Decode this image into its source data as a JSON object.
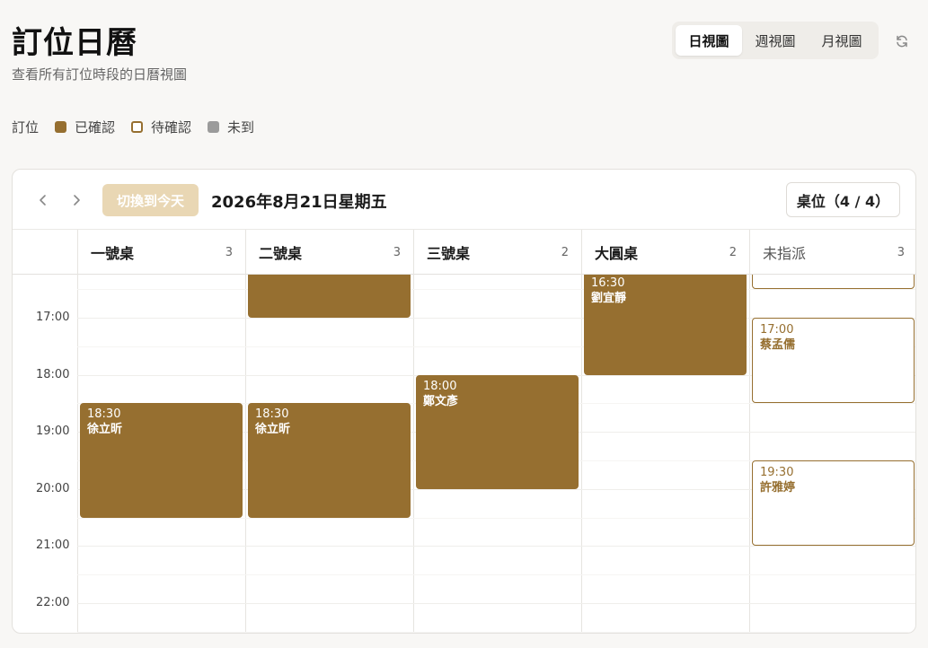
{
  "header": {
    "title": "訂位日曆",
    "subtitle": "查看所有訂位時段的日曆視圖",
    "views": [
      "日視圖",
      "週視圖",
      "月視圖"
    ],
    "active_view": "日視圖"
  },
  "legend": {
    "label": "訂位",
    "items": [
      {
        "label": "已確認",
        "status": "confirmed",
        "color": "#966f30"
      },
      {
        "label": "待確認",
        "status": "pending",
        "color": "#966f30"
      },
      {
        "label": "未到",
        "status": "noshow",
        "color": "#9b9b9b"
      }
    ]
  },
  "toolbar": {
    "today_label": "切換到今天",
    "date_label": "2026年8月21日星期五",
    "tables_label": "桌位（4 / 4）"
  },
  "columns": [
    {
      "name": "一號桌",
      "count": "3"
    },
    {
      "name": "二號桌",
      "count": "3"
    },
    {
      "name": "三號桌",
      "count": "2"
    },
    {
      "name": "大圓桌",
      "count": "2"
    },
    {
      "name": "未指派",
      "count": "3"
    }
  ],
  "time_labels": [
    "17:00",
    "18:00",
    "19:00",
    "20:00",
    "21:00",
    "22:00"
  ],
  "events": [
    {
      "column": 1,
      "time": "",
      "name": "",
      "status": "confirmed",
      "start_hour": 16.2,
      "end_hour": 17.0
    },
    {
      "column": 3,
      "time": "16:30",
      "name": "劉宜靜",
      "status": "confirmed",
      "start_hour": 16.2,
      "end_hour": 18.0
    },
    {
      "column": 4,
      "time": "",
      "name": "",
      "status": "pending",
      "start_hour": 16.2,
      "end_hour": 16.5
    },
    {
      "column": 4,
      "time": "17:00",
      "name": "蔡孟儒",
      "status": "pending",
      "start_hour": 17.0,
      "end_hour": 18.5
    },
    {
      "column": 2,
      "time": "18:00",
      "name": "鄭文彥",
      "status": "confirmed",
      "start_hour": 18.0,
      "end_hour": 20.0
    },
    {
      "column": 0,
      "time": "18:30",
      "name": "徐立昕",
      "status": "confirmed",
      "start_hour": 18.5,
      "end_hour": 20.5
    },
    {
      "column": 1,
      "time": "18:30",
      "name": "徐立昕",
      "status": "confirmed",
      "start_hour": 18.5,
      "end_hour": 20.5
    },
    {
      "column": 4,
      "time": "19:30",
      "name": "許雅婷",
      "status": "pending",
      "start_hour": 19.5,
      "end_hour": 21.0
    }
  ]
}
